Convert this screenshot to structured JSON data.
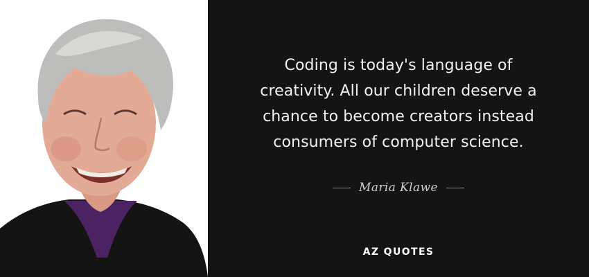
{
  "quote": {
    "lines": [
      "Coding is today's language of",
      "creativity. All our children deserve a",
      "chance to become creators instead",
      "consumers of computer science."
    ]
  },
  "author": {
    "name": "Maria Klawe"
  },
  "brand": {
    "name": "AZ QUOTES"
  },
  "colors": {
    "background": "#141414",
    "quote_text": "#f2f2f2",
    "author_text": "#cfcfcf",
    "brand_text": "#ffffff"
  }
}
